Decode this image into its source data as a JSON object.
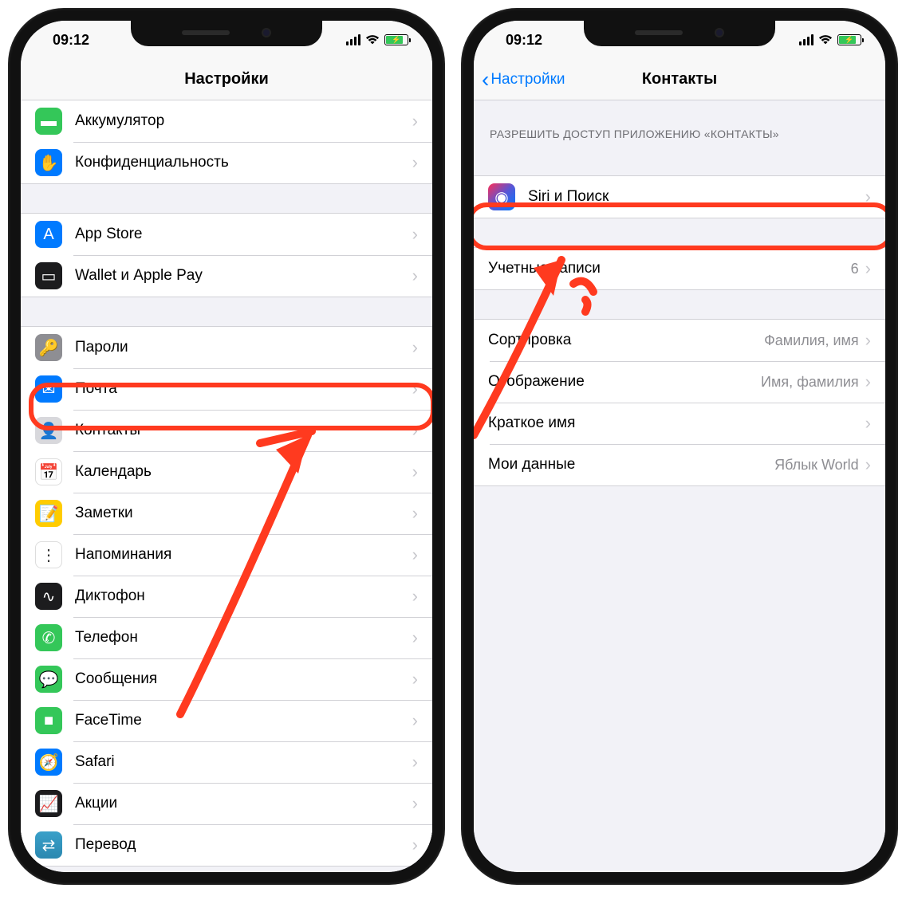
{
  "status": {
    "time": "09:12"
  },
  "left": {
    "title": "Настройки",
    "groups": [
      {
        "items": [
          {
            "icon": "battery-icon",
            "bg": "bg-green",
            "glyph": "▬",
            "label": "Аккумулятор"
          },
          {
            "icon": "privacy-icon",
            "bg": "bg-blue",
            "glyph": "✋",
            "label": "Конфиденциальность"
          }
        ]
      },
      {
        "items": [
          {
            "icon": "appstore-icon",
            "bg": "bg-blue",
            "glyph": "A",
            "label": "App Store"
          },
          {
            "icon": "wallet-icon",
            "bg": "bg-black",
            "glyph": "▭",
            "label": "Wallet и Apple Pay"
          }
        ]
      },
      {
        "items": [
          {
            "icon": "passwords-icon",
            "bg": "bg-grey",
            "glyph": "🔑",
            "label": "Пароли"
          },
          {
            "icon": "mail-icon",
            "bg": "bg-blue",
            "glyph": "✉",
            "label": "Почта"
          },
          {
            "icon": "contacts-icon",
            "bg": "bg-lightgrey",
            "glyph": "👤",
            "label": "Контакты"
          },
          {
            "icon": "calendar-icon",
            "bg": "bg-white",
            "glyph": "📅",
            "label": "Календарь"
          },
          {
            "icon": "notes-icon",
            "bg": "bg-yellow",
            "glyph": "📝",
            "label": "Заметки"
          },
          {
            "icon": "reminders-icon",
            "bg": "bg-white",
            "glyph": "⋮",
            "label": "Напоминания"
          },
          {
            "icon": "voice-memos-icon",
            "bg": "bg-black",
            "glyph": "∿",
            "label": "Диктофон"
          },
          {
            "icon": "phone-icon",
            "bg": "bg-green",
            "glyph": "✆",
            "label": "Телефон"
          },
          {
            "icon": "messages-icon",
            "bg": "bg-green",
            "glyph": "💬",
            "label": "Сообщения"
          },
          {
            "icon": "facetime-icon",
            "bg": "bg-green",
            "glyph": "■",
            "label": "FaceTime"
          },
          {
            "icon": "safari-icon",
            "bg": "bg-blue",
            "glyph": "🧭",
            "label": "Safari"
          },
          {
            "icon": "stocks-icon",
            "bg": "bg-black",
            "glyph": "📈",
            "label": "Акции"
          },
          {
            "icon": "translate-icon",
            "bg": "bg-teal",
            "glyph": "⇄",
            "label": "Перевод"
          }
        ]
      }
    ]
  },
  "right": {
    "back": "Настройки",
    "title": "Контакты",
    "section_header": "РАЗРЕШИТЬ ДОСТУП ПРИЛОЖЕНИЮ «КОНТАКТЫ»",
    "siri_label": "Siri и Поиск",
    "accounts": {
      "label": "Учетные записи",
      "value": "6"
    },
    "sort": {
      "label": "Сортировка",
      "value": "Фамилия, имя"
    },
    "display": {
      "label": "Отображение",
      "value": "Имя, фамилия"
    },
    "shortname": {
      "label": "Краткое имя"
    },
    "mydata": {
      "label": "Мои данные",
      "value": "Яблык World"
    }
  }
}
